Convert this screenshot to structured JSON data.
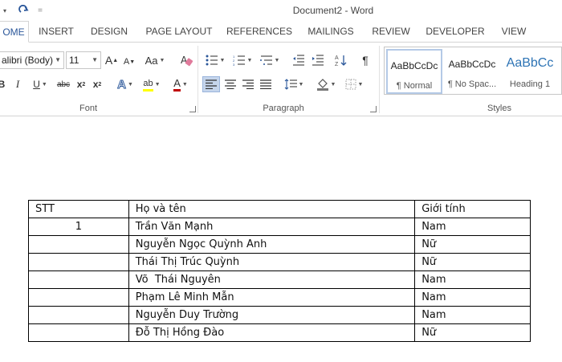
{
  "window": {
    "title": "Document2 - Word"
  },
  "tabs": [
    {
      "label": "OME"
    },
    {
      "label": "INSERT"
    },
    {
      "label": "DESIGN"
    },
    {
      "label": "PAGE LAYOUT"
    },
    {
      "label": "REFERENCES"
    },
    {
      "label": "MAILINGS"
    },
    {
      "label": "REVIEW"
    },
    {
      "label": "DEVELOPER"
    },
    {
      "label": "VIEW"
    }
  ],
  "font_group": {
    "label": "Font",
    "font_name": "alibri (Body)",
    "font_size": "11",
    "grow": "A",
    "shrink": "A",
    "change_case": "Aa",
    "italic": "I",
    "underline": "U",
    "strike": "abc",
    "subscript": "x",
    "superscript": "x",
    "text_effects": "A",
    "highlight": "ab",
    "font_color": "A"
  },
  "paragraph_group": {
    "label": "Paragraph",
    "pilcrow": "¶"
  },
  "styles_group": {
    "label": "Styles",
    "items": [
      {
        "preview": "AaBbCcDc",
        "name": "¶ Normal"
      },
      {
        "preview": "AaBbCcDc",
        "name": "¶ No Spac..."
      },
      {
        "preview": "AaBbCc",
        "name": "Heading 1"
      }
    ]
  },
  "table": {
    "headers": [
      "STT",
      "Họ và tên",
      "Giới tính"
    ],
    "rows": [
      [
        "1",
        "Trần Văn Mạnh",
        "Nam"
      ],
      [
        "",
        "Nguyễn Ngọc Quỳnh Anh",
        "Nữ"
      ],
      [
        "",
        "Thái Thị Trúc Quỳnh",
        "Nữ"
      ],
      [
        "",
        "Võ  Thái Nguyên",
        "Nam"
      ],
      [
        "",
        "Phạm Lê Minh Mẫn",
        "Nam"
      ],
      [
        "",
        "Nguyễn Duy Trường",
        "Nam"
      ],
      [
        "",
        "Đỗ Thị Hồng Đào",
        "Nữ"
      ]
    ]
  },
  "colors": {
    "accent": "#2b579a",
    "heading_blue": "#2e74b5",
    "selection": "#c5d5ec"
  }
}
